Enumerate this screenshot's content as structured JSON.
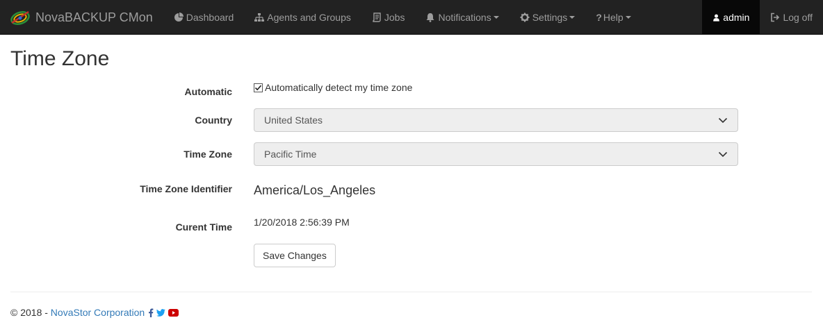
{
  "navbar": {
    "brand": "NovaBACKUP CMon",
    "items": [
      {
        "label": "Dashboard",
        "icon": "pie-chart-icon",
        "dropdown": false
      },
      {
        "label": "Agents and Groups",
        "icon": "sitemap-icon",
        "dropdown": false
      },
      {
        "label": "Jobs",
        "icon": "scroll-icon",
        "dropdown": false
      },
      {
        "label": "Notifications",
        "icon": "bell-icon",
        "dropdown": true
      },
      {
        "label": "Settings",
        "icon": "gear-icon",
        "dropdown": true
      },
      {
        "label": "Help",
        "icon": "question-icon",
        "dropdown": true
      }
    ],
    "user": "admin",
    "logoff": "Log off"
  },
  "page": {
    "title": "Time Zone"
  },
  "form": {
    "automatic_label": "Automatic",
    "automatic_checkbox_text": "Automatically detect my time zone",
    "automatic_checked": true,
    "country_label": "Country",
    "country_value": "United States",
    "timezone_label": "Time Zone",
    "timezone_value": "Pacific Time",
    "identifier_label": "Time Zone Identifier",
    "identifier_value": "America/Los_Angeles",
    "current_time_label": "Curent Time",
    "current_time_value": "1/20/2018 2:56:39 PM",
    "save_button": "Save Changes"
  },
  "footer": {
    "copyright": "© 2018 - ",
    "company": "NovaStor Corporation"
  },
  "colors": {
    "navbar_bg": "#222222",
    "nav_text": "#9d9d9d",
    "link": "#337ab7",
    "facebook": "#3b5998",
    "twitter": "#1da1f2",
    "youtube": "#cc0000"
  }
}
